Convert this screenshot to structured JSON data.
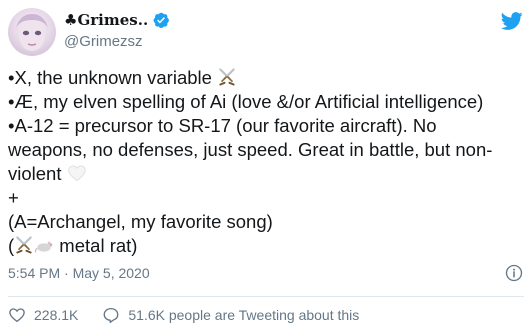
{
  "author": {
    "display_name": "♣Grimes..",
    "handle": "@Grimezsz",
    "verified": true,
    "avatar_icon": "avatar-portrait"
  },
  "tweet": {
    "lines": [
      {
        "text": "•X, the unknown variable ",
        "emoji": "crossed-swords"
      },
      {
        "text": "•Æ, my elven spelling of Ai (love &/or Artificial intelligence)"
      },
      {
        "text": "•A-12 = precursor to SR-17 (our favorite aircraft).  No"
      },
      {
        "text": "weapons, no defenses, just speed.  Great in battle, but non-"
      },
      {
        "text": "violent ",
        "emoji": "white-heart"
      },
      {
        "text": "+"
      },
      {
        "text": "(A=Archangel, my favorite song)"
      },
      {
        "text_before": "(",
        "emojis": [
          "crossed-swords",
          "rat"
        ],
        "text_after": " metal rat)"
      }
    ]
  },
  "meta": {
    "timestamp": "5:54 PM · May 5, 2020"
  },
  "actions": {
    "likes": "228.1K",
    "retweet_text": "51.6K people are Tweeting about this"
  },
  "colors": {
    "twitter_blue": "#1da1f2",
    "secondary_text": "#657786",
    "divider": "#e1e8ed"
  }
}
